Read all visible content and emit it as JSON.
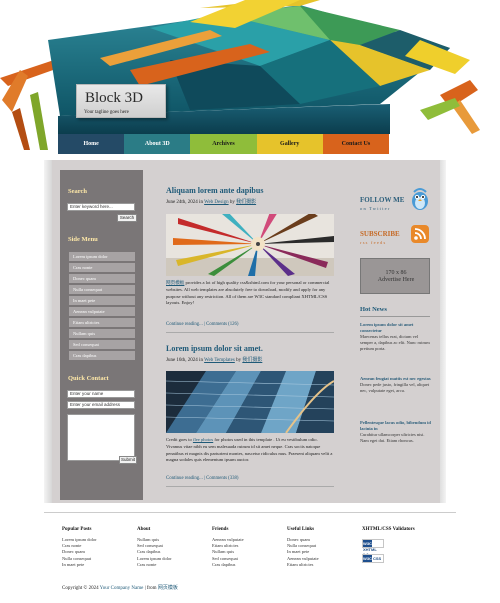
{
  "header": {
    "title": "Block 3D",
    "tagline": "Your tagline goes here"
  },
  "nav": [
    {
      "label": "Home"
    },
    {
      "label": "About 3D"
    },
    {
      "label": "Archives"
    },
    {
      "label": "Gallery"
    },
    {
      "label": "Contact Us"
    }
  ],
  "sidebar": {
    "search_title": "Search",
    "search_value": "Enter keyword here...",
    "search_button": "Search",
    "menu_title": "Side Menu",
    "menu": [
      "Lorem ipsum dolor",
      "Cras nonte",
      "Donec quam",
      "Nulla consequat",
      "In maet pete",
      "Aenean vulputate",
      "Etiam ultricies",
      "Nullam quis",
      "Sed consequat",
      "Cras dapibus"
    ],
    "contact_title": "Quick Contact",
    "contact_name": "Enter your name",
    "contact_email": "Enter your email address",
    "contact_button": "Submit"
  },
  "posts": [
    {
      "title": "Aliquam lorem ante dapibus",
      "date": "June 24th, 2024 in",
      "category": "Web Design",
      "by": "by",
      "author": "我们摄影",
      "text_link": "网页模板",
      "text": "provides a lot of high quality css&xhtml.com for your personal or commercial websites. All web templates are absolutely free to download, modify and apply for any purpose without any restriction. All of them are W3C standard compliant XHTML/CSS layouts. Enjoy!",
      "read_more": "Continue reading...",
      "comments": "Comments (126)"
    },
    {
      "title": "Lorem ipsum dolor sit amet.",
      "date": "June 16th, 2024 in",
      "category": "Web Templates",
      "by": "by",
      "author": "我们摄影",
      "text_prefix": "Credit goes to",
      "text_link": "flee photos",
      "text": "for photos used in this template . Ut eu vestibulum odio. Vivamus vitae nibh eu sem malesuada rutrum id sit amet neque. Cras sociis natoque penatibus et magnis dis parturient montes, nascetur ridiculus mus. Praesent aliquam velit a magna sodales quis elementum ipsum auctor.",
      "read_more": "Continue reading...",
      "comments": "Comments (338)"
    }
  ],
  "right": {
    "follow_title": "FOLLOW ME",
    "follow_sub": "on Twitter",
    "subscribe_title": "SUBSCRIBE",
    "subscribe_sub": "rss feeds",
    "ad_size": "170 x 86",
    "ad_text": "Advertise Here",
    "news_title": "Hot News",
    "news": [
      {
        "title": "Lorem ipsum dolor sit amet consectetur",
        "body": "Maecenas tellus erat, dictum vel semper a, dapibus ac elit. Nunc rutrum pretium porta."
      },
      {
        "title": "Aenean feugiat mattis est nec egestas",
        "body": "Donec pede justo, fringilla vel, aliquet nec, vulputate eget, arcu."
      },
      {
        "title": "Pellentesque lacus odio, bibendum id lacinia in",
        "body": "Curabitur ullamcorper ultricies nisi. Nam eget dui. Etiam rhoncus."
      }
    ]
  },
  "footer": {
    "cols": [
      {
        "title": "Popular Posts",
        "items": [
          "Lorem ipsum dolor",
          "Cras nonte",
          "Donec quam",
          "Nulla consequat",
          "In maet pete"
        ]
      },
      {
        "title": "About",
        "items": [
          "Nullam quis",
          "Sed consequat",
          "Cras dapibus",
          "Lorem ipsum dolor",
          "Cras nonte"
        ]
      },
      {
        "title": "Friends",
        "items": [
          "Aenean vulputate",
          "Etiam ultricies",
          "Nullam quis",
          "Sed consequat",
          "Cras dapibus"
        ]
      },
      {
        "title": "Useful Links",
        "items": [
          "Donec quam",
          "Nulla consequat",
          "In maet pete",
          "Aenean vulputate",
          "Etiam ultricies"
        ]
      },
      {
        "title": "XHTML/CSS Validators",
        "items": []
      }
    ],
    "w3c_xhtml": "XHTML 1.0",
    "w3c_css": "CSS",
    "copyright_prefix": "Copyright © 2024",
    "company": "Your Company Name",
    "sep": "| from",
    "from_link": "网页模板"
  },
  "colors": {
    "nav1": "#244a66",
    "nav2": "#2b7c86",
    "nav3": "#8fbd3a",
    "nav4": "#e6c32b",
    "nav5": "#d8631c",
    "sidebar": "#7a7677",
    "content": "#d4d0d0",
    "title": "#1f5a78"
  }
}
